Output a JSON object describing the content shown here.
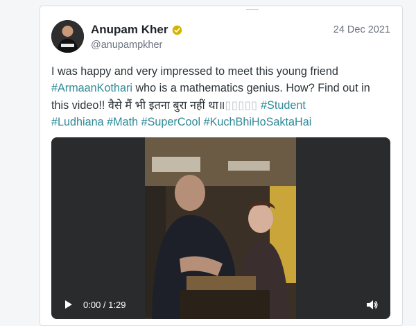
{
  "post": {
    "author": {
      "name": "Anupam Kher",
      "handle": "@anupampkher",
      "verified_icon": "verified-badge-icon",
      "verified_color": "#d4b400"
    },
    "date": "24 Dec 2021",
    "text": {
      "line1": "I was happy and very impressed to meet this young friend",
      "tag_armaan": "#ArmaanKothari",
      "line2_rest": " who is a mathematics genius. How? Find out in",
      "line3_start": "this video!! वैसे मैं भी इतना बुरा नहीं था॥",
      "emoji_placeholder": "▯▯▯▯▯",
      "tag_student": "#Student",
      "tag_ludhiana": "#Ludhiana",
      "tag_math": "#Math",
      "tag_supercool": "#SuperCool",
      "tag_kuchbhi": "#KuchBhiHoSaktaHai"
    },
    "hashtag_color": "#2d8a97",
    "video": {
      "time_display": "0:00 / 1:29",
      "play_icon": "play-icon",
      "volume_icon": "volume-icon"
    }
  }
}
